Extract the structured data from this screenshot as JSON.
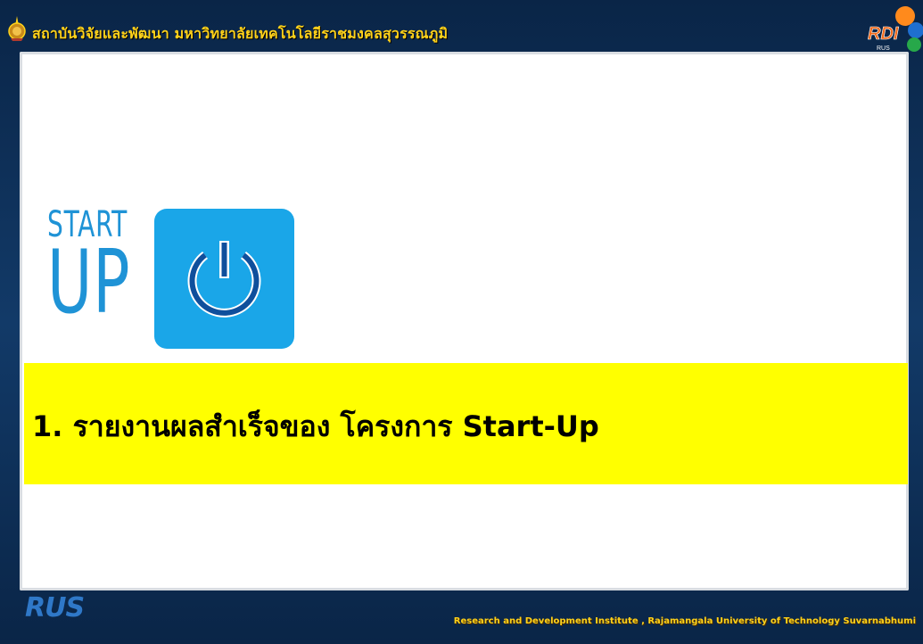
{
  "header": {
    "title": "สถาบันวิจัยและพัฒนา  มหาวิทยาลัยเทคโนโลยีราชมงคลสุวรรณภูมิ",
    "logo_text": "RDI"
  },
  "slide": {
    "logo_word_1": "START",
    "logo_word_2": "UP",
    "logo_icon": "power-icon",
    "banner_text": "1.  รายงานผลสำเร็จของ โครงการ Start-Up",
    "banner_color": "#ffff00"
  },
  "footer": {
    "logo": "RUS",
    "text": "Research and Development Institute , Rajamangala University of Technology Suvarnabhumi"
  },
  "colors": {
    "frame": "#0c2a4e",
    "header_text": "#ffd21a",
    "startup_blue": "#1aa6e8"
  }
}
